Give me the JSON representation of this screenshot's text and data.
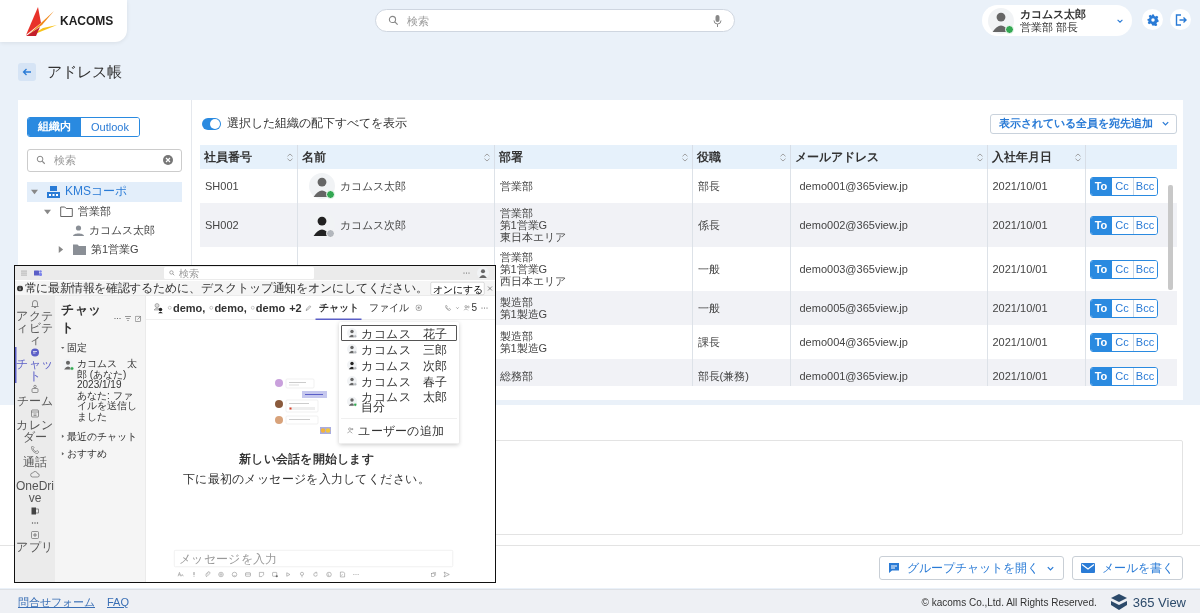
{
  "header": {
    "logo": "KACOMS",
    "search": {
      "placeholder": "検索"
    },
    "user": {
      "name": "カコムス太郎",
      "title": "営業部 部長",
      "online": true
    }
  },
  "page_title": "アドレス帳",
  "source_tabs": [
    {
      "label": "組織内",
      "selected": true
    },
    {
      "label": "Outlook",
      "selected": false
    }
  ],
  "tree_search": {
    "placeholder": "検索"
  },
  "tree": [
    {
      "label": "KMSコーポ",
      "kind": "company",
      "expanded": true,
      "selected": true,
      "children": [
        {
          "label": "営業部",
          "kind": "folder",
          "expanded": true,
          "selected": false,
          "children": [
            {
              "label": "カコムス太郎",
              "kind": "person",
              "selected": false
            },
            {
              "label": "第1営業G",
              "kind": "group",
              "expanded": false,
              "selected": false
            }
          ]
        }
      ]
    }
  ],
  "toggle": {
    "label": "選択した組織の配下すべてを表示",
    "on": true
  },
  "add_all_button": "表示されている全員を宛先追加",
  "table": {
    "columns": [
      "社員番号",
      "名前",
      "部署",
      "役職",
      "メールアドレス",
      "入社年月日"
    ],
    "rows": [
      {
        "id": "SH001",
        "name": "カコムス太郎",
        "online": true,
        "department": [
          "営業部"
        ],
        "position": "部長",
        "email": "demo001@365view.jp",
        "joined": "2021/10/01",
        "recipient": [
          {
            "label": "To",
            "selected": true
          },
          {
            "label": "Cc",
            "selected": false
          },
          {
            "label": "Bcc",
            "selected": false
          }
        ]
      },
      {
        "id": "SH002",
        "name": "カコムス次郎",
        "online": false,
        "department": [
          "営業部",
          "第1営業G",
          "東日本エリア"
        ],
        "position": "係長",
        "email": "demo002@365view.jp",
        "joined": "2021/10/01",
        "recipient": [
          {
            "label": "To",
            "selected": true
          },
          {
            "label": "Cc",
            "selected": false
          },
          {
            "label": "Bcc",
            "selected": false
          }
        ]
      },
      {
        "department": [
          "営業部",
          "第1営業G",
          "西日本エリア"
        ],
        "position": "一般",
        "email": "demo003@365view.jp",
        "joined": "2021/10/01",
        "recipient": [
          {
            "label": "To",
            "selected": true
          },
          {
            "label": "Cc",
            "selected": false
          },
          {
            "label": "Bcc",
            "selected": false
          }
        ]
      },
      {
        "department": [
          "製造部",
          "第1製造G"
        ],
        "position": "一般",
        "email": "demo005@365view.jp",
        "joined": "2021/10/01",
        "recipient": [
          {
            "label": "To",
            "selected": true
          },
          {
            "label": "Cc",
            "selected": false
          },
          {
            "label": "Bcc",
            "selected": false
          }
        ]
      },
      {
        "department": [
          "製造部",
          "第1製造G"
        ],
        "position": "課長",
        "email": "demo004@365view.jp",
        "joined": "2021/10/01",
        "recipient": [
          {
            "label": "To",
            "selected": true
          },
          {
            "label": "Cc",
            "selected": false
          },
          {
            "label": "Bcc",
            "selected": false
          }
        ]
      },
      {
        "department": [
          "総務部"
        ],
        "position": "部長(兼務)",
        "email": "demo001@365view.jp",
        "joined": "2021/10/01",
        "recipient": [
          {
            "label": "To",
            "selected": true
          },
          {
            "label": "Cc",
            "selected": false
          },
          {
            "label": "Bcc",
            "selected": false
          }
        ]
      }
    ]
  },
  "buttons": [
    {
      "label": "グループチャットを開く",
      "kind": "chat"
    },
    {
      "label": "メールを書く",
      "kind": "mail"
    }
  ],
  "footer": {
    "links": [
      "問合せフォーム",
      "FAQ"
    ],
    "copyright": "© kacoms Co.,Ltd. All Rights Reserved.",
    "brand": "365 View"
  },
  "teams_window": {
    "search": {
      "placeholder": "検索"
    },
    "notice": {
      "text": "常に最新情報を確認するために、デスクトップ通知をオンにしてください。",
      "button": "オンにする"
    },
    "rail": [
      {
        "label": "アクティビティ",
        "kind": "bell",
        "selected": false
      },
      {
        "label": "チャット",
        "kind": "chat",
        "selected": true
      },
      {
        "label": "チーム",
        "kind": "teams",
        "selected": false
      },
      {
        "label": "カレンダー",
        "kind": "calendar",
        "selected": false
      },
      {
        "label": "通話",
        "kind": "call",
        "selected": false
      },
      {
        "label": "OneDrive",
        "kind": "cloud",
        "selected": false
      },
      {
        "kind": "office",
        "selected": false
      },
      {
        "kind": "more",
        "selected": false
      },
      {
        "label": "アプリ",
        "kind": "apps",
        "selected": false
      }
    ],
    "chat_list": {
      "title": "チャット",
      "sections": [
        {
          "title": "固定",
          "expanded": true,
          "items": [
            {
              "name": "カコムス　太郎 (あなた)",
              "date": "2023/1/19",
              "preview": "あなた: ファイルを送信しました",
              "online": true
            }
          ]
        },
        {
          "title": "最近のチャット",
          "expanded": false
        },
        {
          "title": "おすすめ",
          "expanded": false
        }
      ]
    },
    "conversation": {
      "participants": [
        "demo,",
        "demo,",
        "demo"
      ],
      "extra": "+2",
      "tabs": [
        {
          "label": "チャット",
          "selected": true
        },
        {
          "label": "ファイル",
          "selected": false
        }
      ],
      "people_count": "5",
      "menu": {
        "people": [
          {
            "name": "カコムス　花子",
            "selected": true,
            "online": false
          },
          {
            "name": "カコムス　三郎",
            "selected": false,
            "online": false
          },
          {
            "name": "カコムス　次郎",
            "selected": false,
            "online": false
          },
          {
            "name": "カコムス　春子",
            "selected": false,
            "online": false
          },
          {
            "name": "カコムス　太郎",
            "note": "自分",
            "selected": false,
            "online": true
          }
        ],
        "add_user": "ユーザーの追加"
      },
      "empty_title": "新しい会話を開始します",
      "empty_hint": "下に最初のメッセージを入力してください。",
      "compose": {
        "placeholder": "メッセージを入力"
      }
    }
  }
}
